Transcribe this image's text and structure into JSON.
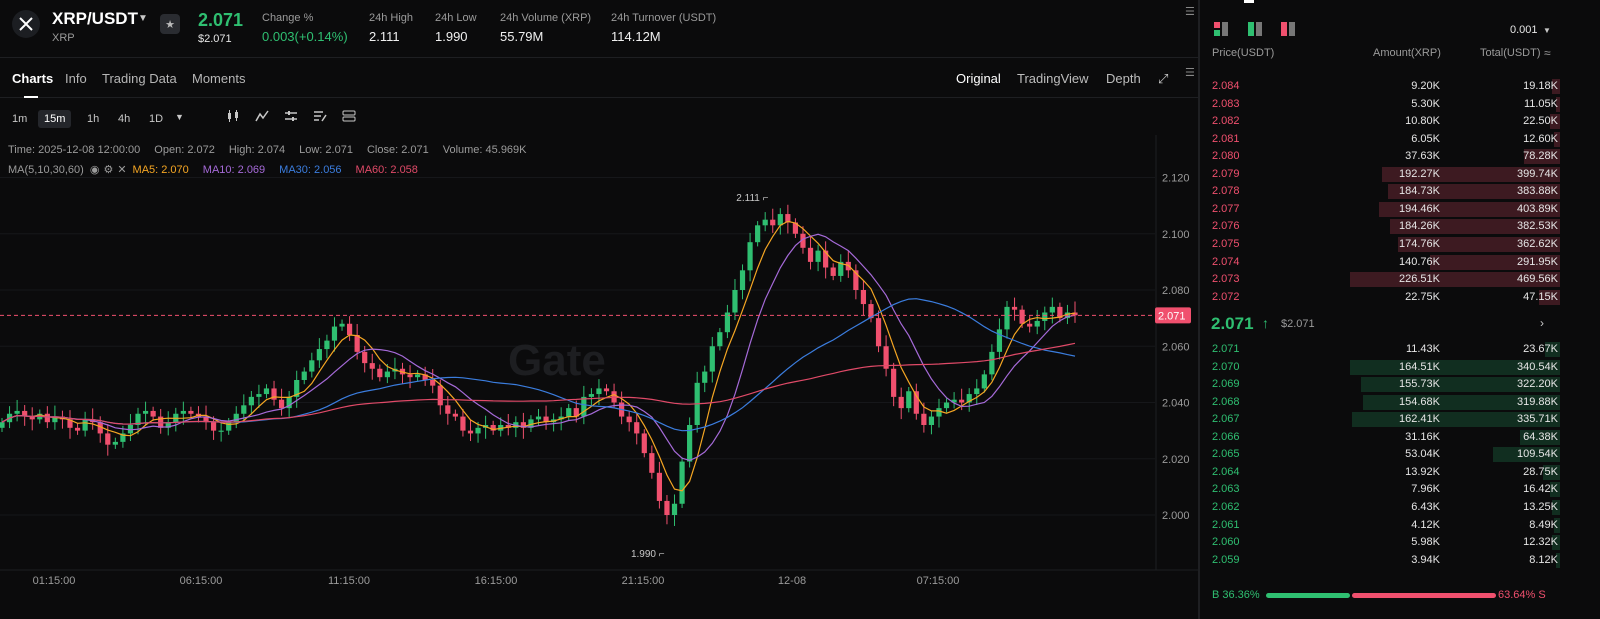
{
  "header": {
    "pair": "XRP/USDT",
    "coin": "XRP",
    "last_price": "2.071",
    "last_price_usd": "$2.071",
    "stats": [
      {
        "label": "Change %",
        "value": "0.003(+0.14%)",
        "positive": true
      },
      {
        "label": "24h High",
        "value": "2.111"
      },
      {
        "label": "24h Low",
        "value": "1.990"
      },
      {
        "label": "24h Volume (XRP)",
        "value": "55.79M"
      },
      {
        "label": "24h Turnover (USDT)",
        "value": "114.12M"
      }
    ]
  },
  "tabs": [
    "Charts",
    "Info",
    "Trading Data",
    "Moments"
  ],
  "views": [
    "Original",
    "TradingView",
    "Depth"
  ],
  "timeframes": [
    "1m",
    "15m",
    "1h",
    "4h",
    "1D"
  ],
  "info": {
    "time": "Time: 2025-12-08 12:00:00",
    "open": "Open: 2.072",
    "high": "High: 2.074",
    "low": "Low: 2.071",
    "close": "Close: 2.071",
    "volume": "Volume: 45.969K"
  },
  "ma": {
    "label": "MA(5,10,30,60)",
    "ma5": "MA5: 2.070",
    "ma10": "MA10: 2.069",
    "ma30": "MA30: 2.056",
    "ma60": "MA60: 2.058",
    "colors": {
      "ma5": "#f5a623",
      "ma10": "#a56ad8",
      "ma30": "#3b7dde",
      "ma60": "#e04a68"
    }
  },
  "chart_data": {
    "type": "candlestick",
    "y_ticks": [
      "2.120",
      "2.100",
      "2.080",
      "2.060",
      "2.040",
      "2.020",
      "2.000"
    ],
    "ylim": [
      1.984,
      2.128
    ],
    "x_ticks": [
      "01:15:00",
      "06:15:00",
      "11:15:00",
      "16:15:00",
      "21:15:00",
      "12-08",
      "07:15:00"
    ],
    "current_price_label": "2.071",
    "current_price": 2.071,
    "high_marker": "2.111",
    "low_marker": "1.990",
    "watermark": "Gate",
    "up_color": "#2fbf71",
    "down_color": "#f0506e",
    "candles_close": [
      2.033,
      2.036,
      2.037,
      2.035,
      2.034,
      2.036,
      2.033,
      2.035,
      2.034,
      2.031,
      2.03,
      2.034,
      2.033,
      2.029,
      2.025,
      2.026,
      2.029,
      2.032,
      2.036,
      2.037,
      2.035,
      2.031,
      2.033,
      2.036,
      2.037,
      2.036,
      2.035,
      2.033,
      2.03,
      2.03,
      2.033,
      2.036,
      2.039,
      2.042,
      2.043,
      2.045,
      2.041,
      2.038,
      2.042,
      2.048,
      2.051,
      2.055,
      2.059,
      2.062,
      2.067,
      2.068,
      2.064,
      2.058,
      2.054,
      2.052,
      2.049,
      2.051,
      2.052,
      2.05,
      2.049,
      2.05,
      2.048,
      2.046,
      2.039,
      2.036,
      2.035,
      2.03,
      2.029,
      2.031,
      2.032,
      2.03,
      2.032,
      2.031,
      2.033,
      2.031,
      2.034,
      2.035,
      2.033,
      2.034,
      2.035,
      2.038,
      2.035,
      2.042,
      2.043,
      2.045,
      2.044,
      2.04,
      2.035,
      2.033,
      2.029,
      2.022,
      2.015,
      2.005,
      2.0,
      2.004,
      2.019,
      2.032,
      2.047,
      2.051,
      2.06,
      2.065,
      2.072,
      2.08,
      2.087,
      2.097,
      2.103,
      2.105,
      2.103,
      2.107,
      2.104,
      2.1,
      2.095,
      2.09,
      2.094,
      2.088,
      2.085,
      2.09,
      2.087,
      2.08,
      2.075,
      2.07,
      2.06,
      2.052,
      2.042,
      2.038,
      2.044,
      2.036,
      2.032,
      2.035,
      2.038,
      2.04,
      2.041,
      2.04,
      2.043,
      2.045,
      2.05,
      2.058,
      2.066,
      2.074,
      2.073,
      2.068,
      2.067,
      2.069,
      2.072,
      2.074,
      2.07,
      2.072,
      2.071
    ],
    "series": [
      {
        "name": "MA5"
      },
      {
        "name": "MA10"
      },
      {
        "name": "MA30"
      },
      {
        "name": "MA60"
      }
    ]
  },
  "orderbook": {
    "precision": "0.001",
    "headers": {
      "price": "Price(USDT)",
      "amount": "Amount(XRP)",
      "total": "Total(USDT)"
    },
    "asks": [
      {
        "price": "2.084",
        "amount": "9.20K",
        "total": "19.18K",
        "depth": 0.04
      },
      {
        "price": "2.083",
        "amount": "5.30K",
        "total": "11.05K",
        "depth": 0.02
      },
      {
        "price": "2.082",
        "amount": "10.80K",
        "total": "22.50K",
        "depth": 0.05
      },
      {
        "price": "2.081",
        "amount": "6.05K",
        "total": "12.60K",
        "depth": 0.03
      },
      {
        "price": "2.080",
        "amount": "37.63K",
        "total": "78.28K",
        "depth": 0.17
      },
      {
        "price": "2.079",
        "amount": "192.27K",
        "total": "399.74K",
        "depth": 0.85
      },
      {
        "price": "2.078",
        "amount": "184.73K",
        "total": "383.88K",
        "depth": 0.82
      },
      {
        "price": "2.077",
        "amount": "194.46K",
        "total": "403.89K",
        "depth": 0.86
      },
      {
        "price": "2.076",
        "amount": "184.26K",
        "total": "382.53K",
        "depth": 0.81
      },
      {
        "price": "2.075",
        "amount": "174.76K",
        "total": "362.62K",
        "depth": 0.77
      },
      {
        "price": "2.074",
        "amount": "140.76K",
        "total": "291.95K",
        "depth": 0.62
      },
      {
        "price": "2.073",
        "amount": "226.51K",
        "total": "469.56K",
        "depth": 1.0
      },
      {
        "price": "2.072",
        "amount": "22.75K",
        "total": "47.15K",
        "depth": 0.1
      }
    ],
    "mid_price": "2.071",
    "mid_price_usd": "$2.071",
    "bids": [
      {
        "price": "2.071",
        "amount": "11.43K",
        "total": "23.67K",
        "depth": 0.07
      },
      {
        "price": "2.070",
        "amount": "164.51K",
        "total": "340.54K",
        "depth": 1.0
      },
      {
        "price": "2.069",
        "amount": "155.73K",
        "total": "322.20K",
        "depth": 0.95
      },
      {
        "price": "2.068",
        "amount": "154.68K",
        "total": "319.88K",
        "depth": 0.94
      },
      {
        "price": "2.067",
        "amount": "162.41K",
        "total": "335.71K",
        "depth": 0.99
      },
      {
        "price": "2.066",
        "amount": "31.16K",
        "total": "64.38K",
        "depth": 0.19
      },
      {
        "price": "2.065",
        "amount": "53.04K",
        "total": "109.54K",
        "depth": 0.32
      },
      {
        "price": "2.064",
        "amount": "13.92K",
        "total": "28.75K",
        "depth": 0.08
      },
      {
        "price": "2.063",
        "amount": "7.96K",
        "total": "16.42K",
        "depth": 0.05
      },
      {
        "price": "2.062",
        "amount": "6.43K",
        "total": "13.25K",
        "depth": 0.04
      },
      {
        "price": "2.061",
        "amount": "4.12K",
        "total": "8.49K",
        "depth": 0.03
      },
      {
        "price": "2.060",
        "amount": "5.98K",
        "total": "12.32K",
        "depth": 0.04
      },
      {
        "price": "2.059",
        "amount": "3.94K",
        "total": "8.12K",
        "depth": 0.02
      }
    ],
    "buy_ratio_label": "B 36.36%",
    "sell_ratio_label": "63.64% S",
    "buy_ratio": 0.3636,
    "ask_color": "#f0506e",
    "bid_color": "#2fbf71"
  }
}
